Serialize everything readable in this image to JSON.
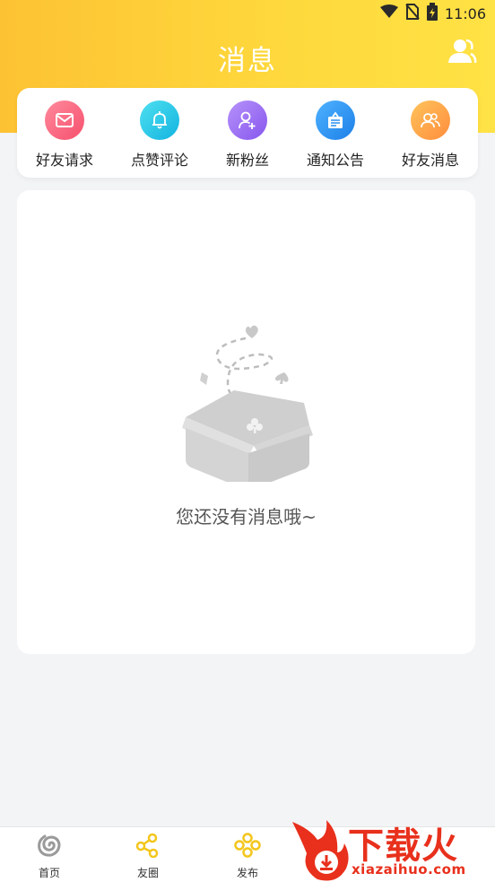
{
  "status_bar": {
    "time": "11:06",
    "icons": [
      "wifi-icon",
      "no-sim-icon",
      "battery-charging-icon"
    ]
  },
  "header": {
    "title": "消息",
    "contacts_icon": "contacts-icon"
  },
  "quick_actions": [
    {
      "label": "好友请求",
      "icon": "mail-icon",
      "color": "#f8617a"
    },
    {
      "label": "点赞评论",
      "icon": "bell-icon",
      "color": "#22c7e8"
    },
    {
      "label": "新粉丝",
      "icon": "add-user-icon",
      "color": "#9c6cf2"
    },
    {
      "label": "通知公告",
      "icon": "notice-icon",
      "color": "#2b8ff0"
    },
    {
      "label": "好友消息",
      "icon": "friends-icon",
      "color": "#ffa64b"
    }
  ],
  "empty_state": {
    "text": "您还没有消息哦~",
    "illustration": "empty-box-icon"
  },
  "bottom_nav": [
    {
      "label": "首页",
      "icon": "swirl-icon",
      "color": "#999999"
    },
    {
      "label": "友圈",
      "icon": "share-icon",
      "color": "#f3c61b"
    },
    {
      "label": "发布",
      "icon": "flower-icon",
      "color": "#f3c61b"
    }
  ],
  "watermark": {
    "brand_cn": "下载火",
    "brand_en": "xiazaihuo.com"
  },
  "colors": {
    "header_start": "#fdc233",
    "header_end": "#ffe245",
    "background": "#f3f4f6",
    "watermark_red": "#e8301c"
  }
}
